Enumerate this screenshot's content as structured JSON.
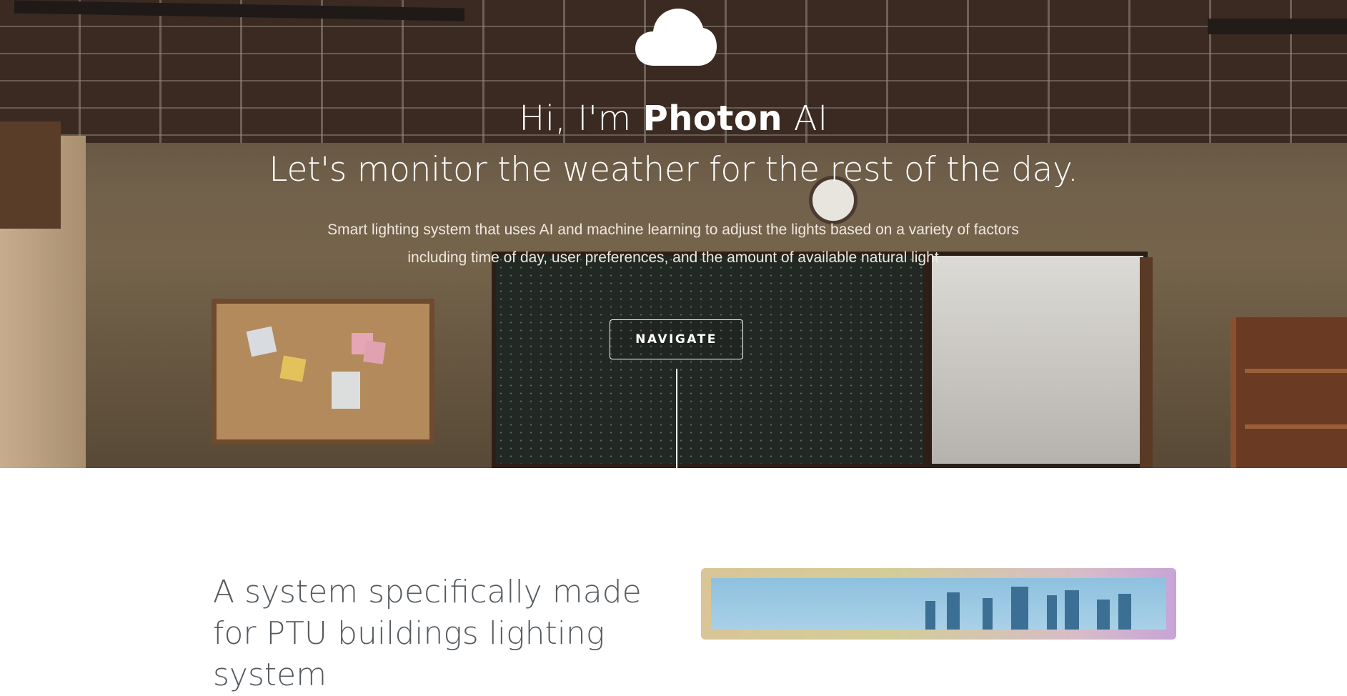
{
  "hero": {
    "icon": "cloud-icon",
    "greeting_prefix": "Hi, I'm ",
    "greeting_brand": "Photon",
    "greeting_suffix": " AI",
    "headline": "Let's monitor the weather for the rest of the day.",
    "description": "Smart lighting system that uses AI and machine learning to adjust the lights based on a variety of factors including time of day, user preferences, and the amount of available natural light",
    "cta_label": "NAVIGATE"
  },
  "section": {
    "heading": "A system specifically made for PTU buildings lighting system"
  }
}
